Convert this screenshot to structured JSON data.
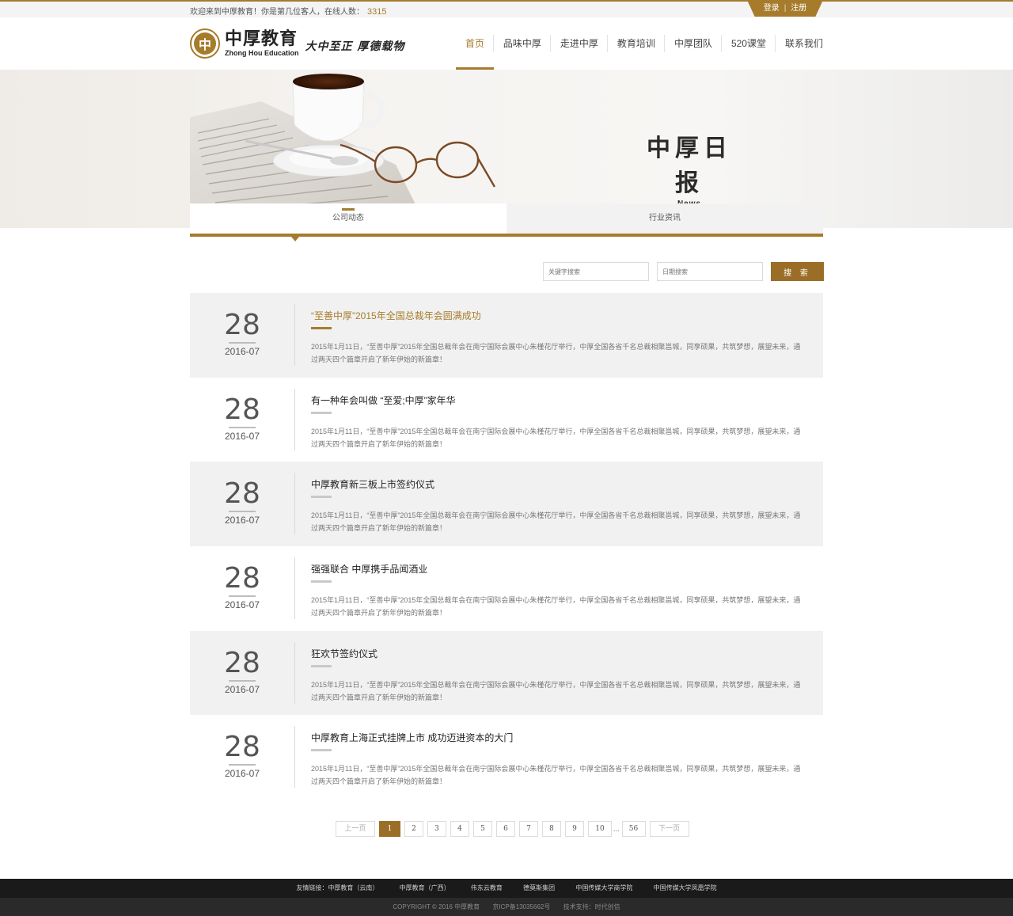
{
  "colors": {
    "accent": "#a67c2c",
    "button": "#9b6e27",
    "footer": "#1a1a1a"
  },
  "topbar": {
    "welcome": "欢迎来到中厚教育！你是第几位客人，在线人数：",
    "online_count": "3315",
    "login": "登录",
    "separator": "|",
    "register": "注册"
  },
  "header": {
    "logo_cn": "中厚教育",
    "logo_en": "Zhong Hou Education",
    "slogan": "大中至正  厚德载物",
    "nav": [
      "首页",
      "品味中厚",
      "走进中厚",
      "教育培训",
      "中厚团队",
      "520课堂",
      "联系我们"
    ]
  },
  "banner": {
    "title": "中厚日报",
    "subtitle": "News"
  },
  "tabs": [
    "公司动态",
    "行业资讯"
  ],
  "search": {
    "keyword_placeholder": "关键字搜索",
    "date_placeholder": "日期搜索",
    "button": "搜 索"
  },
  "news": [
    {
      "day": "28",
      "month": "2016-07",
      "title": "“至善中厚”2015年全国总裁年会圆满成功",
      "summary": "2015年1月11日，“至善中厚”2015年全国总裁年会在南宁国际会展中心朱槿花厅举行，中厚全国各省千名总裁相聚邕城，同享硕果，共筑梦想，展望未来，通过两天四个篇章开启了新年伊始的新篇章！"
    },
    {
      "day": "28",
      "month": "2016-07",
      "title": "有一种年会叫做 “至爱;中厚”家年华",
      "summary": "2015年1月11日，“至善中厚”2015年全国总裁年会在南宁国际会展中心朱槿花厅举行，中厚全国各省千名总裁相聚邕城，同享硕果，共筑梦想，展望未来，通过两天四个篇章开启了新年伊始的新篇章！"
    },
    {
      "day": "28",
      "month": "2016-07",
      "title": "中厚教育新三板上市签约仪式",
      "summary": "2015年1月11日，“至善中厚”2015年全国总裁年会在南宁国际会展中心朱槿花厅举行，中厚全国各省千名总裁相聚邕城，同享硕果，共筑梦想，展望未来，通过两天四个篇章开启了新年伊始的新篇章！"
    },
    {
      "day": "28",
      "month": "2016-07",
      "title": "强强联合 中厚携手品闻酒业",
      "summary": "2015年1月11日，“至善中厚”2015年全国总裁年会在南宁国际会展中心朱槿花厅举行，中厚全国各省千名总裁相聚邕城，同享硕果，共筑梦想，展望未来，通过两天四个篇章开启了新年伊始的新篇章！"
    },
    {
      "day": "28",
      "month": "2016-07",
      "title": "狂欢节签约仪式",
      "summary": "2015年1月11日，“至善中厚”2015年全国总裁年会在南宁国际会展中心朱槿花厅举行，中厚全国各省千名总裁相聚邕城，同享硕果，共筑梦想，展望未来，通过两天四个篇章开启了新年伊始的新篇章！"
    },
    {
      "day": "28",
      "month": "2016-07",
      "title": "中厚教育上海正式挂牌上市 成功迈进资本的大门",
      "summary": "2015年1月11日，“至善中厚”2015年全国总裁年会在南宁国际会展中心朱槿花厅举行，中厚全国各省千名总裁相聚邕城，同享硕果，共筑梦想，展望未来，通过两天四个篇章开启了新年伊始的新篇章！"
    }
  ],
  "pagination": {
    "prev": "上一页",
    "pages": [
      "1",
      "2",
      "3",
      "4",
      "5",
      "6",
      "7",
      "8",
      "9",
      "10"
    ],
    "dots": "...",
    "last": "56",
    "next": "下一页"
  },
  "footer": {
    "links": [
      "友情链接：中厚教育（云南）",
      "中厚教育（广西）",
      "伟东云教育",
      "德莫斯集团",
      "中国传媒大学商学院",
      "中国传媒大学凤凰学院"
    ],
    "copyright": "COPYRIGHT © 2016  中厚教育",
    "icp": "京ICP备13035662号",
    "support": "技术支持：时代创信"
  }
}
